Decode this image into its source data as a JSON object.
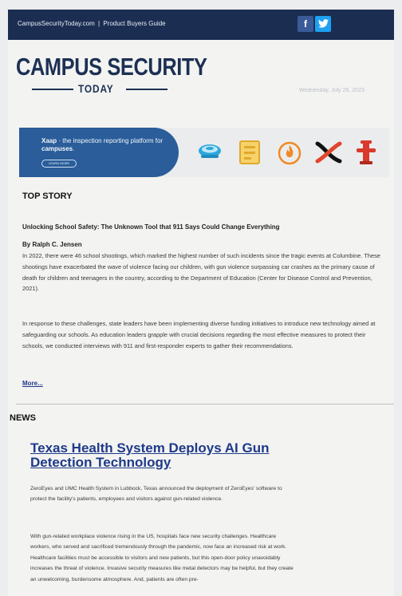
{
  "header": {
    "site_link": "CampusSecurityToday.com",
    "separator": "|",
    "guide_link": "Product Buyers Guide",
    "facebook_glyph": "f",
    "brand_color": "#1b2e52"
  },
  "masthead": {
    "logo_main": "CAMPUS SECURITY",
    "logo_sub": "TODAY",
    "date": "Wednesday, July 26, 2023"
  },
  "banner": {
    "text_prefix": "Xaap",
    "text_rest": " · the inspection reporting platform for ",
    "text_bold": "campuses",
    "text_end": ".",
    "button_label": "LEARN MORE",
    "icons": [
      "smoke-detector-icon",
      "fire-panel-icon",
      "flame-icon",
      "xaap-logo-icon",
      "fire-hydrant-icon"
    ]
  },
  "top_story": {
    "section_label": "TOP STORY",
    "headline": "Unlocking School Safety: The Unknown Tool that 911 Says Could Change Everything",
    "byline": "By Ralph C. Jensen",
    "paragraph1": "In 2022, there were 46 school shootings, which marked the highest number of such incidents since the tragic events at Columbine. These shootings have exacerbated the wave of violence facing our children, with gun violence surpassing car crashes as the primary cause of death for children and teenagers in the country, according to the Department of Education (Center for Disease Control and Prevention, 2021).",
    "paragraph2": "In response to these challenges, state leaders have been implementing diverse funding initiatives to introduce new technology aimed at safeguarding our schools. As education leaders grapple with crucial decisions regarding the most effective measures to protect their schools, we conducted interviews with 911 and first-responder experts to gather their recommendations.",
    "more_link": "More..."
  },
  "news": {
    "section_label": "NEWS",
    "headline": "Texas Health System Deploys AI Gun Detection Technology",
    "paragraph1": "ZeroEyes and UMC Health System in Lubbock, Texas announced the deployment of ZeroEyes' software to protect the facility's patients, employees and visitors against gun-related violence.",
    "paragraph2": "With gun-related workplace violence rising in the US, hospitals face new security challenges. Healthcare workers, who served and sacrificed tremendously through the pandemic, now face an increased risk at work. Healthcare facilities must be accessible to visitors and new patients, but this open-door policy unavoidably increases the threat of violence. Invasive security measures like metal detectors may be helpful, but they create an unwelcoming, burdensome atmosphere. And, patients are often pre-"
  }
}
